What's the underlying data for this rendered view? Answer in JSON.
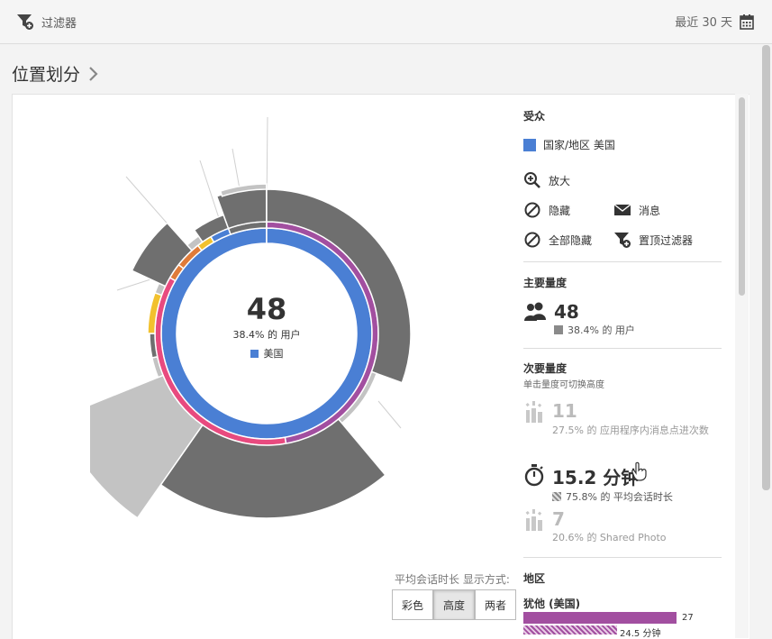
{
  "topbar": {
    "filter_label": "过滤器",
    "date_range_label": "最近 30 天"
  },
  "page": {
    "title": "位置划分"
  },
  "center": {
    "value": "48",
    "subtitle": "38.4% 的 用户",
    "legend_label": "美国",
    "legend_color": "#4a7fd4"
  },
  "audience": {
    "header": "受众",
    "item_label": "国家/地区 美国",
    "item_color": "#4a7fd4",
    "actions": {
      "zoom": "放大",
      "hide": "隐藏",
      "message": "消息",
      "hide_all": "全部隐藏",
      "pin_filter": "置顶过滤器"
    }
  },
  "primary_metric": {
    "header": "主要量度",
    "value": "48",
    "detail": "38.4% 的 用户"
  },
  "secondary_metric": {
    "header": "次要量度",
    "hint": "单击量度可切换高度",
    "items": [
      {
        "value": "11",
        "detail": "27.5% 的 应用程序内消息点进次数"
      },
      {
        "value": "15.2 分钟",
        "detail": "75.8% 的 平均会话时长"
      },
      {
        "value": "7",
        "detail": "20.6% 的 Shared Photo"
      }
    ]
  },
  "region": {
    "header": "地区",
    "item_label": "犹他 (美国)",
    "bar_value": "27",
    "bar_sub_value": "24.5 分钟",
    "bar_color": "#a24fa0"
  },
  "display_mode": {
    "label": "平均会话时长 显示方式:",
    "options": [
      "彩色",
      "高度",
      "两者"
    ],
    "selected": "高度"
  },
  "colors": {
    "blue": "#4a7fd4",
    "purple": "#a24fa0",
    "pink": "#e84a7f",
    "orange": "#e07b39",
    "yellow": "#f2c12e",
    "dark_gray": "#6f6f6f",
    "light_gray": "#c3c3c3"
  }
}
